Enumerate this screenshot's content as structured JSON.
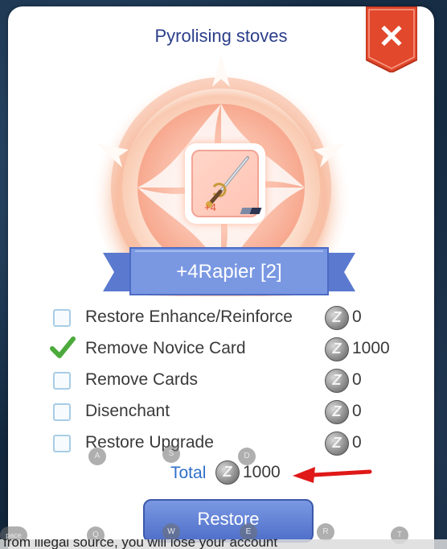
{
  "dialog": {
    "title": "Pyrolising stoves",
    "close_label": "✕"
  },
  "item": {
    "refine": "+4",
    "name": "+4Rapier [2]",
    "icon": "rapier-sword-icon"
  },
  "options": [
    {
      "label": "Restore Enhance/Reinforce",
      "checked": false,
      "cost": "0"
    },
    {
      "label": "Remove Novice Card",
      "checked": true,
      "cost": "1000"
    },
    {
      "label": "Remove Cards",
      "checked": false,
      "cost": "0"
    },
    {
      "label": "Disenchant",
      "checked": false,
      "cost": "0"
    },
    {
      "label": "Restore Upgrade",
      "checked": false,
      "cost": "0"
    }
  ],
  "currency": {
    "symbol": "Z",
    "icon": "zeny-coin-icon"
  },
  "total": {
    "label": "Total",
    "value": "1000"
  },
  "restore_button": {
    "label": "Restore"
  },
  "key_hints": [
    "A",
    "S",
    "D",
    "pace",
    "Q",
    "W",
    "E",
    "R",
    "T"
  ],
  "chat": {
    "text": "from illegal source, you will lose your account"
  },
  "colors": {
    "title": "#2b3e8a",
    "ribbon": "#6f8fdc",
    "button": "#5b7bd2",
    "close": "#e2482c",
    "check": "#4caa3c",
    "annotation_arrow": "#e01818"
  }
}
